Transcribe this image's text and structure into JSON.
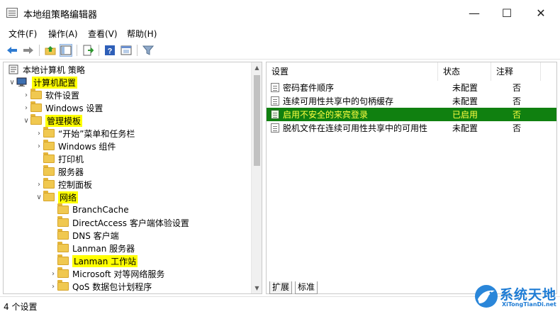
{
  "window": {
    "title": "本地组策略编辑器",
    "minimize_glyph": "—",
    "maximize_glyph": "☐",
    "close_glyph": "✕"
  },
  "menu": [
    "文件(F)",
    "操作(A)",
    "查看(V)",
    "帮助(H)"
  ],
  "toolbar_icons": [
    "back-arrow-icon",
    "forward-arrow-icon",
    "up-folder-icon",
    "show-hide-tree-icon",
    "export-list-icon",
    "help-icon",
    "properties-view-icon",
    "filter-icon"
  ],
  "tree": {
    "root": "本地计算机 策略",
    "items": [
      {
        "label": "计算机配置",
        "highlight": true
      },
      {
        "label": "软件设置",
        "highlight": false
      },
      {
        "label": "Windows 设置",
        "highlight": false
      },
      {
        "label": "管理模板",
        "highlight": true
      },
      {
        "label": "“开始”菜单和任务栏",
        "highlight": false
      },
      {
        "label": "Windows 组件",
        "highlight": false
      },
      {
        "label": "打印机",
        "highlight": false
      },
      {
        "label": "服务器",
        "highlight": false
      },
      {
        "label": "控制面板",
        "highlight": false
      },
      {
        "label": "网络",
        "highlight": true
      },
      {
        "label": "BranchCache",
        "highlight": false
      },
      {
        "label": "DirectAccess 客户端体验设置",
        "highlight": false
      },
      {
        "label": "DNS 客户端",
        "highlight": false
      },
      {
        "label": "Lanman 服务器",
        "highlight": false
      },
      {
        "label": "Lanman 工作站",
        "highlight": true
      },
      {
        "label": "Microsoft 对等网络服务",
        "highlight": false
      },
      {
        "label": "QoS 数据包计划程序",
        "highlight": false
      }
    ]
  },
  "settings": {
    "columns": {
      "setting": "设置",
      "state": "状态",
      "note": "注释"
    },
    "rows": [
      {
        "name": "密码套件顺序",
        "state": "未配置",
        "note": "否"
      },
      {
        "name": "连续可用性共享中的句柄缓存",
        "state": "未配置",
        "note": "否"
      },
      {
        "name": "启用不安全的来宾登录",
        "state": "已启用",
        "note": "否",
        "selected": true
      },
      {
        "name": "脱机文件在连续可用性共享中的可用性",
        "state": "未配置",
        "note": "否"
      }
    ]
  },
  "tabs": [
    "扩展",
    "标准"
  ],
  "status": "4 个设置",
  "watermark": {
    "name": "系统天地",
    "url": "XiTongTianDi.net"
  },
  "colors": {
    "selected_row": "#108010",
    "selected_text": "#ffff40",
    "highlight": "#ffff00",
    "brand": "#1d7bd4"
  }
}
